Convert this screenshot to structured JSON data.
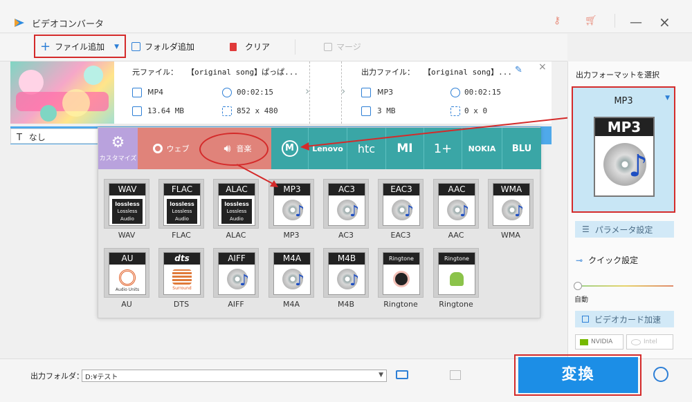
{
  "app": {
    "title": "ビデオコンバータ"
  },
  "window_controls": {
    "minimize": "—",
    "close": "×"
  },
  "toolbar": {
    "add_file": "ファイル追加",
    "add_folder": "フォルダ追加",
    "clear": "クリア",
    "merge": "マージ"
  },
  "file": {
    "source_label": "元ファイル：",
    "source_name": "【original song】ぱっぱ...",
    "output_label": "出力ファイル：",
    "output_name": "【original song】...",
    "src_format": "MP4",
    "src_duration": "00:02:15",
    "src_size": "13.64 MB",
    "src_resolution": "852 x 480",
    "out_format": "MP3",
    "out_duration": "00:02:15",
    "out_size": "3 MB",
    "out_resolution": "0 x 0"
  },
  "profile": {
    "text": "なし"
  },
  "categories": {
    "custom": "カスタマイズ",
    "web": "ウェブ",
    "music": "音楽",
    "brands": [
      "Lenovo",
      "htc",
      "MI",
      "1+",
      "NOKIA",
      "BLU"
    ]
  },
  "formats": [
    {
      "head": "WAV",
      "label": "WAV",
      "kind": "lossless"
    },
    {
      "head": "FLAC",
      "label": "FLAC",
      "kind": "lossless"
    },
    {
      "head": "ALAC",
      "label": "ALAC",
      "kind": "lossless"
    },
    {
      "head": "MP3",
      "label": "MP3",
      "kind": "disc"
    },
    {
      "head": "AC3",
      "label": "AC3",
      "kind": "disc"
    },
    {
      "head": "EAC3",
      "label": "EAC3",
      "kind": "disc"
    },
    {
      "head": "AAC",
      "label": "AAC",
      "kind": "disc"
    },
    {
      "head": "WMA",
      "label": "WMA",
      "kind": "disc"
    },
    {
      "head": "AU",
      "label": "AU",
      "kind": "au"
    },
    {
      "head": "dts",
      "label": "DTS",
      "kind": "dts"
    },
    {
      "head": "AIFF",
      "label": "AIFF",
      "kind": "disc"
    },
    {
      "head": "M4A",
      "label": "M4A",
      "kind": "disc"
    },
    {
      "head": "M4B",
      "label": "M4B",
      "kind": "disc"
    },
    {
      "head": "Ringtone",
      "label": "Ringtone",
      "kind": "apple"
    },
    {
      "head": "Ringtone",
      "label": "Ringtone",
      "kind": "android"
    }
  ],
  "lossless_text": {
    "logo": "lossless",
    "line1": "Lossless",
    "line2": "Audio"
  },
  "au_text": "Audio Units",
  "dts_text": "Surround",
  "right_panel": {
    "output_format_label": "出力フォーマットを選択",
    "selected_format": "MP3",
    "big_icon_head": "MP3",
    "param_button": "パラメータ設定",
    "quick_label": "クイック設定",
    "auto_label": "自動",
    "gpu_button": "ビデオカード加速",
    "nvidia": "NVIDIA",
    "intel": "Intel"
  },
  "bottom": {
    "output_folder_label": "出力フォルダ：",
    "output_folder_value": "D:¥テスト",
    "convert": "変換"
  },
  "colors": {
    "accent": "#1c8ee6",
    "highlight_red": "#d42a2a",
    "teal": "#3aa6a6",
    "web_red": "#e0837a"
  }
}
